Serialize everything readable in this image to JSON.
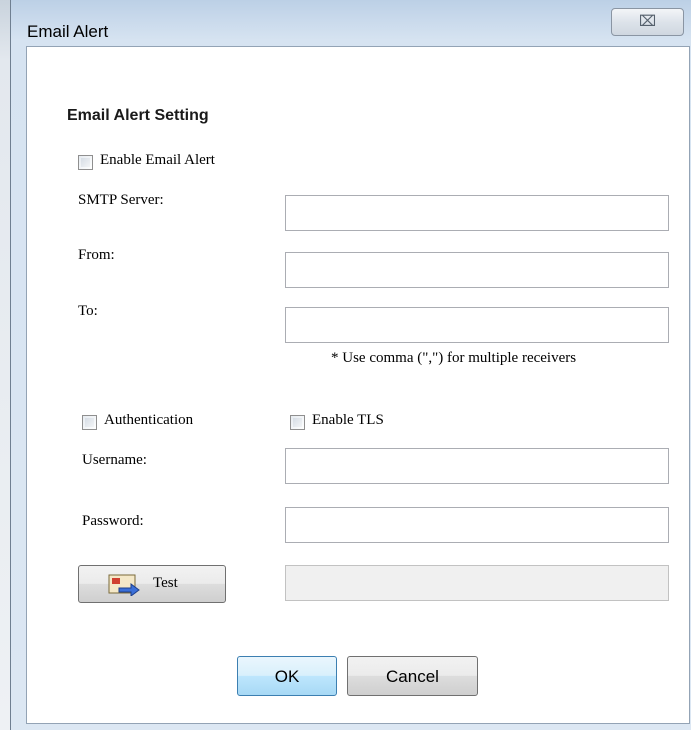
{
  "window": {
    "title": "Email Alert",
    "close_glyph": "⌧"
  },
  "section_title": "Email Alert Setting",
  "enable_alert": {
    "label": "Enable Email Alert",
    "checked": false
  },
  "fields": {
    "smtp": {
      "label": "SMTP Server:",
      "value": ""
    },
    "from": {
      "label": "From:",
      "value": ""
    },
    "to": {
      "label": "To:",
      "value": ""
    },
    "hint": "* Use comma (\",\") for multiple receivers",
    "username": {
      "label": "Username:",
      "value": ""
    },
    "password": {
      "label": "Password:",
      "value": ""
    },
    "test_result": {
      "value": ""
    }
  },
  "authentication": {
    "label": "Authentication",
    "checked": false
  },
  "tls": {
    "label": "Enable TLS",
    "checked": false
  },
  "buttons": {
    "test": "Test",
    "ok": "OK",
    "cancel": "Cancel"
  },
  "icons": {
    "test": "email-send-icon",
    "close": "close-icon"
  },
  "colors": {
    "ok_button": "#bee6fd",
    "title_bar": "#bcd0e6"
  }
}
